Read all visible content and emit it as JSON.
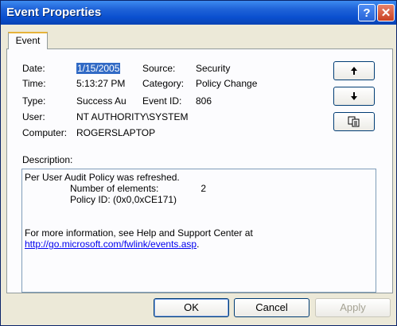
{
  "window": {
    "title": "Event Properties",
    "help_label": "?",
    "close_label": "✕"
  },
  "tabs": [
    {
      "label": "Event"
    }
  ],
  "event": {
    "date_label": "Date:",
    "date": "1/15/2005",
    "source_label": "Source:",
    "source": "Security",
    "time_label": "Time:",
    "time": "5:13:27 PM",
    "category_label": "Category:",
    "category": "Policy Change",
    "type_label": "Type:",
    "type": "Success Au",
    "event_id_label": "Event ID:",
    "event_id": "806",
    "user_label": "User:",
    "user": "NT AUTHORITY\\SYSTEM",
    "computer_label": "Computer:",
    "computer": "ROGERSLAPTOP"
  },
  "side_buttons": {
    "up_icon": "arrow-up-icon",
    "down_icon": "arrow-down-icon",
    "copy_icon": "copy-icon"
  },
  "description": {
    "label": "Description:",
    "line1": "Per User Audit Policy was refreshed.",
    "line2_label": "Number of elements:",
    "line2_value": "2",
    "line3": "Policy ID: (0x0,0xCE171)",
    "line4": "For more information, see Help and Support Center at",
    "link": "http://go.microsoft.com/fwlink/events.asp",
    "link_suffix": "."
  },
  "buttons": {
    "ok": "OK",
    "cancel": "Cancel",
    "apply": "Apply"
  }
}
